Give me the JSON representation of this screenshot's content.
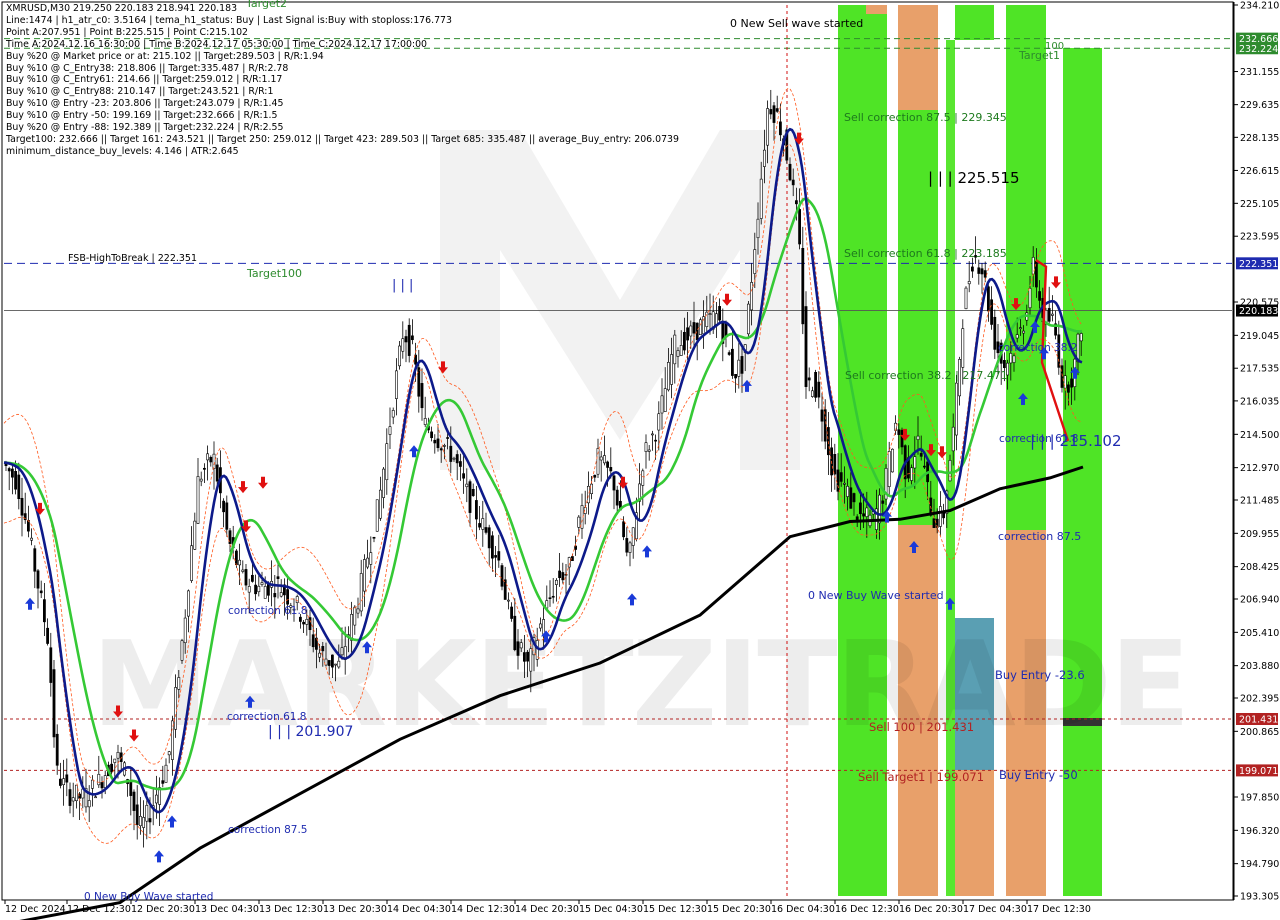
{
  "header": {
    "symbol_line": "XMRUSD,M30  219.250 220.183 218.941 220.183",
    "info_lines": [
      "Line:1474 | h1_atr_c0: 3.5164 | tema_h1_status: Buy | Last Signal is:Buy with stoploss:176.773",
      "Point A:207.951 | Point B:225.515 | Point C:215.102",
      "Time A:2024.12.16 16:30:00 | Time B:2024.12.17 05:30:00 | Time C:2024.12.17 17:00:00",
      "Buy %20 @ Market price or at: 215.102 || Target:289.503 | R/R:1.94",
      "Buy %10 @ C_Entry38: 218.806 || Target:335.487 | R/R:2.78",
      "Buy %10 @ C_Entry61: 214.66 || Target:259.012 | R/R:1.17",
      "Buy %10 @ C_Entry88: 210.147 || Target:243.521 | R/R:1",
      "Buy %10 @ Entry -23: 203.806 || Target:243.079 | R/R:1.45",
      "Buy %10 @ Entry -50: 199.169 || Target:232.666 | R/R:1.5",
      "Buy %20 @ Entry -88: 192.389 || Target:232.224 | R/R:2.55",
      "Target100: 232.666 || Target 161: 243.521 || Target 250: 259.012 || Target 423: 289.503 || Target 685: 335.487 || average_Buy_entry: 206.0739",
      "minimum_distance_buy_levels: 4.146 | ATR:2.645"
    ]
  },
  "chart_data": {
    "type": "candlestick",
    "symbol": "XMRUSD",
    "timeframe": "M30",
    "ylim": [
      193.305,
      234.21
    ],
    "y_ticks": [
      "234.210",
      "232.666",
      "232.224",
      "231.155",
      "229.635",
      "228.135",
      "226.615",
      "225.105",
      "223.595",
      "222.351",
      "220.575",
      "220.183",
      "219.045",
      "217.535",
      "216.035",
      "214.500",
      "212.970",
      "211.485",
      "209.955",
      "208.425",
      "206.940",
      "205.410",
      "203.880",
      "202.395",
      "201.431",
      "200.865",
      "199.071",
      "197.850",
      "196.320",
      "194.790",
      "193.305"
    ],
    "x_labels": [
      "12 Dec 2024",
      "12 Dec 12:30",
      "12 Dec 20:30",
      "13 Dec 04:30",
      "13 Dec 12:30",
      "13 Dec 20:30",
      "14 Dec 04:30",
      "14 Dec 12:30",
      "14 Dec 20:30",
      "15 Dec 04:30",
      "15 Dec 12:30",
      "15 Dec 20:30",
      "16 Dec 04:30",
      "16 Dec 12:30",
      "16 Dec 20:30",
      "17 Dec 04:30",
      "17 Dec 12:30"
    ],
    "price_labels": [
      {
        "value": 232.666,
        "text": "232.666",
        "color": "#2e8b2e"
      },
      {
        "value": 232.224,
        "text": "232.224",
        "color": "#2e8b2e"
      },
      {
        "value": 222.351,
        "text": "222.351",
        "color": "#1f2bb0"
      },
      {
        "value": 220.183,
        "text": "220.183",
        "color": "#000000"
      },
      {
        "value": 201.431,
        "text": "201.431",
        "color": "#b22222"
      },
      {
        "value": 199.071,
        "text": "199.071",
        "color": "#b22222"
      }
    ],
    "annotations": [
      {
        "text": "0 New Sell wave started",
        "color": "#000000"
      },
      {
        "text": "Target2",
        "color": "#2e8b2e"
      },
      {
        "text": "100",
        "color": "#2e8b2e"
      },
      {
        "text": "Target1",
        "color": "#2e8b2e"
      },
      {
        "text": "Sell correction 87.5 | 229.345",
        "color": "#1e7a1e"
      },
      {
        "text": "| | | 225.515",
        "color": "#000000"
      },
      {
        "text": "FSB-HighToBreak | 222.351",
        "color": "#000000"
      },
      {
        "text": "Target100",
        "color": "#2e8b2e"
      },
      {
        "text": "Sell correction 61.8 | 223.185",
        "color": "#1e7a1e"
      },
      {
        "text": "| | |",
        "color": "#1f2bb0"
      },
      {
        "text": "Sell correction 38.2 | 217.471",
        "color": "#1e7a1e"
      },
      {
        "text": "correction 38.2",
        "color": "#1f2bb0"
      },
      {
        "text": "correction 61.8",
        "color": "#1f2bb0"
      },
      {
        "text": "| | | 215.102",
        "color": "#1f2bb0"
      },
      {
        "text": "correction 87.5",
        "color": "#1f2bb0"
      },
      {
        "text": "correction 61.8",
        "color": "#1f2bb0"
      },
      {
        "text": "0 New Buy Wave started",
        "color": "#1f2bb0"
      },
      {
        "text": "correction 61.8",
        "color": "#1f2bb0"
      },
      {
        "text": "| | | 201.907",
        "color": "#1f2bb0"
      },
      {
        "text": "Buy Entry -23.6",
        "color": "#1f2bb0"
      },
      {
        "text": "Sell 100 | 201.431",
        "color": "#b22222"
      },
      {
        "text": "Sell Target1 | 199.071",
        "color": "#b22222"
      },
      {
        "text": "Buy Entry -50",
        "color": "#1f2bb0"
      },
      {
        "text": "correction 87.5",
        "color": "#1f2bb0"
      },
      {
        "text": "0 New Buy Wave started",
        "color": "#1f2bb0"
      }
    ],
    "watermark": "MARKETZITRADE",
    "colors": {
      "bullish_zone": "#46e31a",
      "bearish_zone": "#e8a06a",
      "entry_zone": "#5a9fb3",
      "fast_ma": "#0d1a8a",
      "slow_ma": "#35c935",
      "long_ma": "#000000",
      "envelope": "#ff5a1f",
      "sell_arrow": "#e01010",
      "buy_arrow": "#1a3ad8"
    }
  }
}
